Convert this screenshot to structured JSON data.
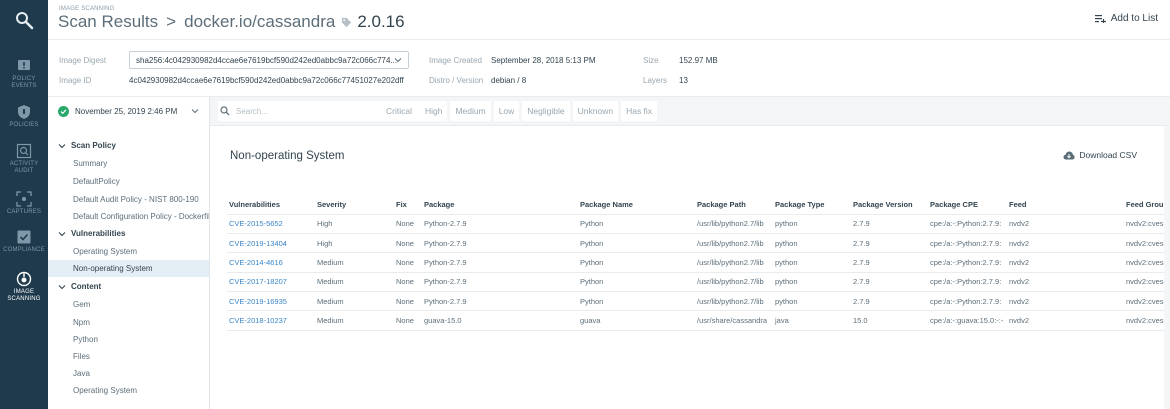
{
  "rail": {
    "items": [
      {
        "label": "POLICY EVENTS",
        "icon": "alert-icon"
      },
      {
        "label": "POLICIES",
        "icon": "shield-icon"
      },
      {
        "label": "ACTIVITY AUDIT",
        "icon": "search-icon"
      },
      {
        "label": "CAPTURES",
        "icon": "capture-icon"
      },
      {
        "label": "COMPLIANCE",
        "icon": "check-icon"
      },
      {
        "label": "IMAGE SCANNING",
        "icon": "scan-icon"
      }
    ]
  },
  "header": {
    "eyebrow": "IMAGE SCANNING",
    "crumb_root": "Scan Results",
    "separator": ">",
    "image": "docker.io/cassandra",
    "version": "2.0.16",
    "add_to_list": "Add to List"
  },
  "info": {
    "digest_label": "Image Digest",
    "digest_value": "sha256:4c042930982d4ccae6e7619bcf590d242ed0abbc9a72c066c774...",
    "id_label": "Image ID",
    "id_value": "4c042930982d4ccae6e7619bcf590d242ed0abbc9a72c066c77451027e202dff",
    "created_label": "Image Created",
    "created_value": "September 28, 2018 5:13 PM",
    "distro_label": "Distro / Version",
    "distro_value": "debian / 8",
    "size_label": "Size",
    "size_value": "152.97 MB",
    "layers_label": "Layers",
    "layers_value": "13"
  },
  "toolbar": {
    "scan_date": "November 25, 2019 2:46 PM",
    "search_placeholder": "Search...",
    "filters": [
      "Critical",
      "High",
      "Medium",
      "Low",
      "Negligible",
      "Unknown",
      "Has fix"
    ]
  },
  "tree": {
    "sections": [
      {
        "label": "Scan Policy",
        "items": [
          "Summary",
          "DefaultPolicy",
          "Default Audit Policy - NIST 800-190",
          "Default Configuration Policy - Dockerfile"
        ]
      },
      {
        "label": "Vulnerabilities",
        "items": [
          "Operating System",
          "Non-operating System"
        ]
      },
      {
        "label": "Content",
        "items": [
          "Gem",
          "Npm",
          "Python",
          "Files",
          "Java",
          "Operating System"
        ]
      }
    ],
    "selected": "Non-operating System"
  },
  "main": {
    "title": "Non-operating System",
    "download": "Download CSV",
    "columns": [
      "Vulnerabilities",
      "Severity",
      "Fix",
      "Package",
      "Package Name",
      "Package Path",
      "Package Type",
      "Package Version",
      "Package CPE",
      "Feed",
      "Feed Group"
    ],
    "rows": [
      [
        "CVE-2015-5652",
        "High",
        "None",
        "Python-2.7.9",
        "Python",
        "/usr/lib/python2.7/lib",
        "python",
        "2.7.9",
        "cpe:/a:-:Python:2.7.9:",
        "nvdv2",
        "nvdv2:cves"
      ],
      [
        "CVE-2019-13404",
        "High",
        "None",
        "Python-2.7.9",
        "Python",
        "/usr/lib/python2.7/lib",
        "python",
        "2.7.9",
        "cpe:/a:-:Python:2.7.9:",
        "nvdv2",
        "nvdv2:cves"
      ],
      [
        "CVE-2014-4616",
        "Medium",
        "None",
        "Python-2.7.9",
        "Python",
        "/usr/lib/python2.7/lib",
        "python",
        "2.7.9",
        "cpe:/a:-:Python:2.7.9:",
        "nvdv2",
        "nvdv2:cves"
      ],
      [
        "CVE-2017-18207",
        "Medium",
        "None",
        "Python-2.7.9",
        "Python",
        "/usr/lib/python2.7/lib",
        "python",
        "2.7.9",
        "cpe:/a:-:Python:2.7.9:",
        "nvdv2",
        "nvdv2:cves"
      ],
      [
        "CVE-2019-16935",
        "Medium",
        "None",
        "Python-2.7.9",
        "Python",
        "/usr/lib/python2.7/lib",
        "python",
        "2.7.9",
        "cpe:/a:-:Python:2.7.9:",
        "nvdv2",
        "nvdv2:cves"
      ],
      [
        "CVE-2018-10237",
        "Medium",
        "None",
        "guava-15.0",
        "guava",
        "/usr/share/cassandra",
        "java",
        "15.0",
        "cpe:/a:-:guava:15.0:-:-",
        "nvdv2",
        "nvdv2:cves"
      ]
    ]
  },
  "colors": {
    "rail_bg": "#1e3a4c",
    "link": "#3a86c8",
    "success": "#2aa86b",
    "selected_bg": "#e4eef5"
  }
}
